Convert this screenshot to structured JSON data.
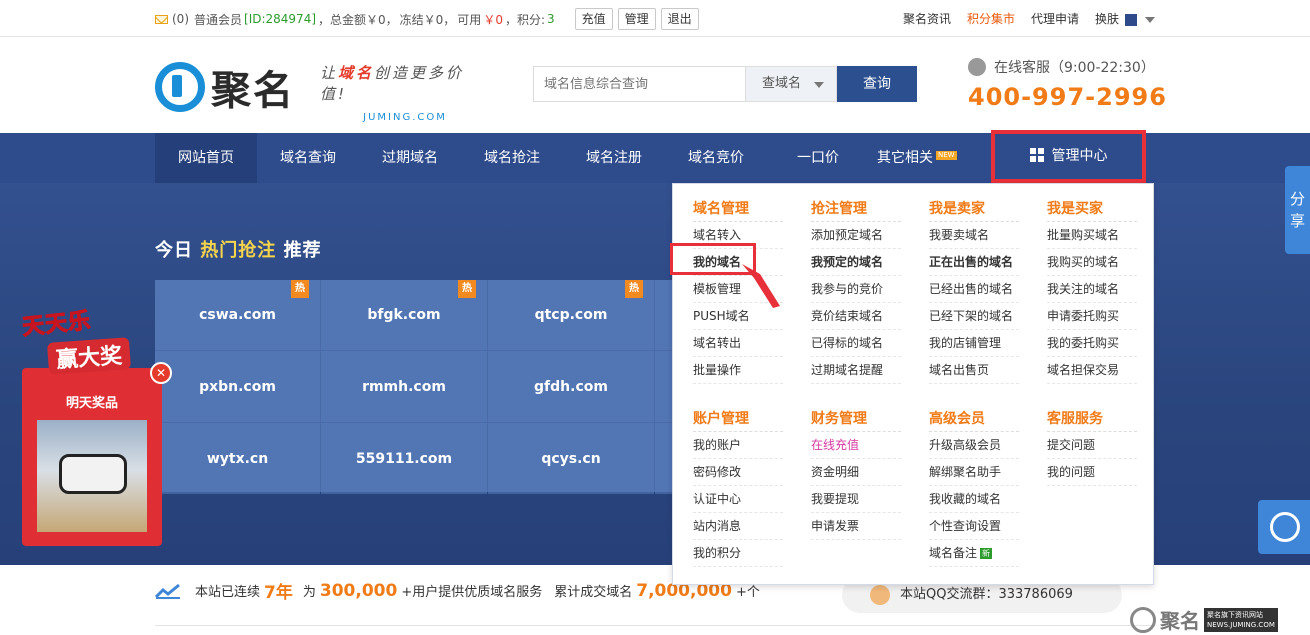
{
  "topbar": {
    "msg_count": "(0)",
    "member_type": "普通会员",
    "user_id": "[ID:284974]",
    "balance_label": "，总金额￥0，",
    "frozen_label": "冻结￥0，",
    "available_prefix": "可用",
    "available_value": "￥0",
    "points_prefix": "，积分:",
    "points_value": "3",
    "recharge": "充值",
    "manage": "管理",
    "logout": "退出",
    "right_links": [
      "聚名资讯",
      "积分集市",
      "代理申请",
      "换肤"
    ]
  },
  "header": {
    "logo_text": "聚名",
    "slogan_prefix": "让",
    "slogan_highlight": "域名",
    "slogan_suffix": "创造更多价值!",
    "slogan_domain": "JUMING.COM",
    "search_placeholder": "域名信息综合查询",
    "search_select": "查域名",
    "search_button": "查询",
    "service_label": "在线客服（9:00-22:30）",
    "phone": "400-997-2996"
  },
  "nav": {
    "items": [
      "网站首页",
      "域名查询",
      "过期域名",
      "域名抢注",
      "域名注册",
      "域名竞价",
      "一口价",
      "其它相关"
    ],
    "new_badge": "NEW",
    "management": "管理中心"
  },
  "banner": {
    "title_prefix": "今日",
    "title_highlight": "热门抢注",
    "title_suffix": "推荐",
    "hot_tag": "热",
    "domains": [
      [
        "cswa.com",
        "bfgk.com",
        "qtcp.com"
      ],
      [
        "pxbn.com",
        "rmmh.com",
        "gfdh.com"
      ],
      [
        "wytx.cn",
        "559111.com",
        "qcys.cn"
      ]
    ]
  },
  "promo": {
    "title1": "天天乐",
    "title2": "赢大奖",
    "label": "明天奖品"
  },
  "side": {
    "share": "分享"
  },
  "dropdown": {
    "columns": [
      {
        "title": "域名管理",
        "items": [
          "域名转入",
          "我的域名",
          "模板管理",
          "PUSH域名",
          "域名转出",
          "批量操作"
        ]
      },
      {
        "title": "抢注管理",
        "items": [
          "添加预定域名",
          "我预定的域名",
          "我参与的竞价",
          "竞价结束域名",
          "已得标的域名",
          "过期域名提醒"
        ]
      },
      {
        "title": "我是卖家",
        "items": [
          "我要卖域名",
          "正在出售的域名",
          "已经出售的域名",
          "已经下架的域名",
          "我的店铺管理",
          "域名出售页"
        ]
      },
      {
        "title": "我是买家",
        "items": [
          "批量购买域名",
          "我购买的域名",
          "我关注的域名",
          "申请委托购买",
          "我的委托购买",
          "域名担保交易"
        ]
      },
      {
        "title": "账户管理",
        "items": [
          "我的账户",
          "密码修改",
          "认证中心",
          "站内消息",
          "我的积分"
        ]
      },
      {
        "title": "财务管理",
        "items": [
          "在线充值",
          "资金明细",
          "我要提现",
          "申请发票"
        ]
      },
      {
        "title": "高级会员",
        "items": [
          "升级高级会员",
          "解绑聚名助手",
          "我收藏的域名",
          "个性查询设置",
          "域名备注"
        ]
      },
      {
        "title": "客服服务",
        "items": [
          "提交问题",
          "我的问题"
        ]
      }
    ],
    "new_tag": "新"
  },
  "stats": {
    "p1": "本站已连续",
    "years": "7年",
    "p2": "为",
    "users": "300,000",
    "p3": "+用户提供优质域名服务",
    "p4": "累计成交域名",
    "deals": "7,000,000",
    "p5": "+个",
    "qq": "本站QQ交流群：333786069"
  },
  "watermark": {
    "text": "聚名",
    "tag1": "聚名旗下资讯网站",
    "tag2": "NEWS.JUMING.COM"
  },
  "colors": {
    "nav": "#2e4b8c",
    "accent": "#f07b17",
    "highlight": "#e8303a"
  }
}
